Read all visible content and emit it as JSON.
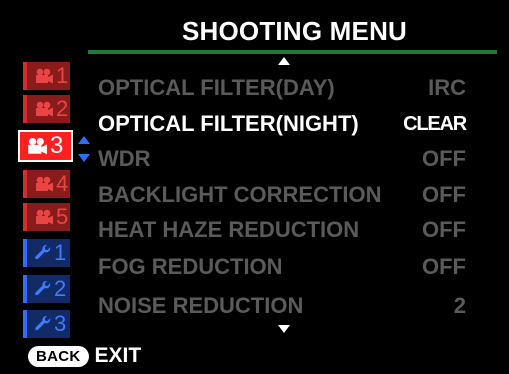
{
  "header": {
    "title": "SHOOTING MENU"
  },
  "tabs": [
    {
      "icon": "movie-camera-icon",
      "number": "1",
      "kind": "shooting",
      "active": false
    },
    {
      "icon": "movie-camera-icon",
      "number": "2",
      "kind": "shooting",
      "active": false
    },
    {
      "icon": "movie-camera-icon",
      "number": "3",
      "kind": "shooting",
      "active": true
    },
    {
      "icon": "movie-camera-icon",
      "number": "4",
      "kind": "shooting",
      "active": false
    },
    {
      "icon": "movie-camera-icon",
      "number": "5",
      "kind": "shooting",
      "active": false
    },
    {
      "icon": "wrench-icon",
      "number": "1",
      "kind": "setup",
      "active": false
    },
    {
      "icon": "wrench-icon",
      "number": "2",
      "kind": "setup",
      "active": false
    },
    {
      "icon": "wrench-icon",
      "number": "3",
      "kind": "setup",
      "active": false
    }
  ],
  "menu": {
    "items": [
      {
        "label": "OPTICAL FILTER(DAY)",
        "value": "IRC",
        "selected": false
      },
      {
        "label": "OPTICAL FILTER(NIGHT)",
        "value": "CLEAR",
        "selected": true
      },
      {
        "label": "WDR",
        "value": "OFF",
        "selected": false
      },
      {
        "label": "BACKLIGHT CORRECTION",
        "value": "OFF",
        "selected": false
      },
      {
        "label": "HEAT HAZE REDUCTION",
        "value": "OFF",
        "selected": false
      },
      {
        "label": "FOG REDUCTION",
        "value": "OFF",
        "selected": false
      },
      {
        "label": "NOISE REDUCTION",
        "value": "2",
        "selected": false
      }
    ]
  },
  "footer": {
    "back_label": "BACK",
    "exit_label": "EXIT"
  },
  "colors": {
    "accent_green": "#1f7a3a",
    "shooting_tab_red": "#d82b2b",
    "setup_tab_blue": "#2f6dff",
    "active_tab": "#ff2020",
    "dim_text": "#5a5a5a"
  }
}
